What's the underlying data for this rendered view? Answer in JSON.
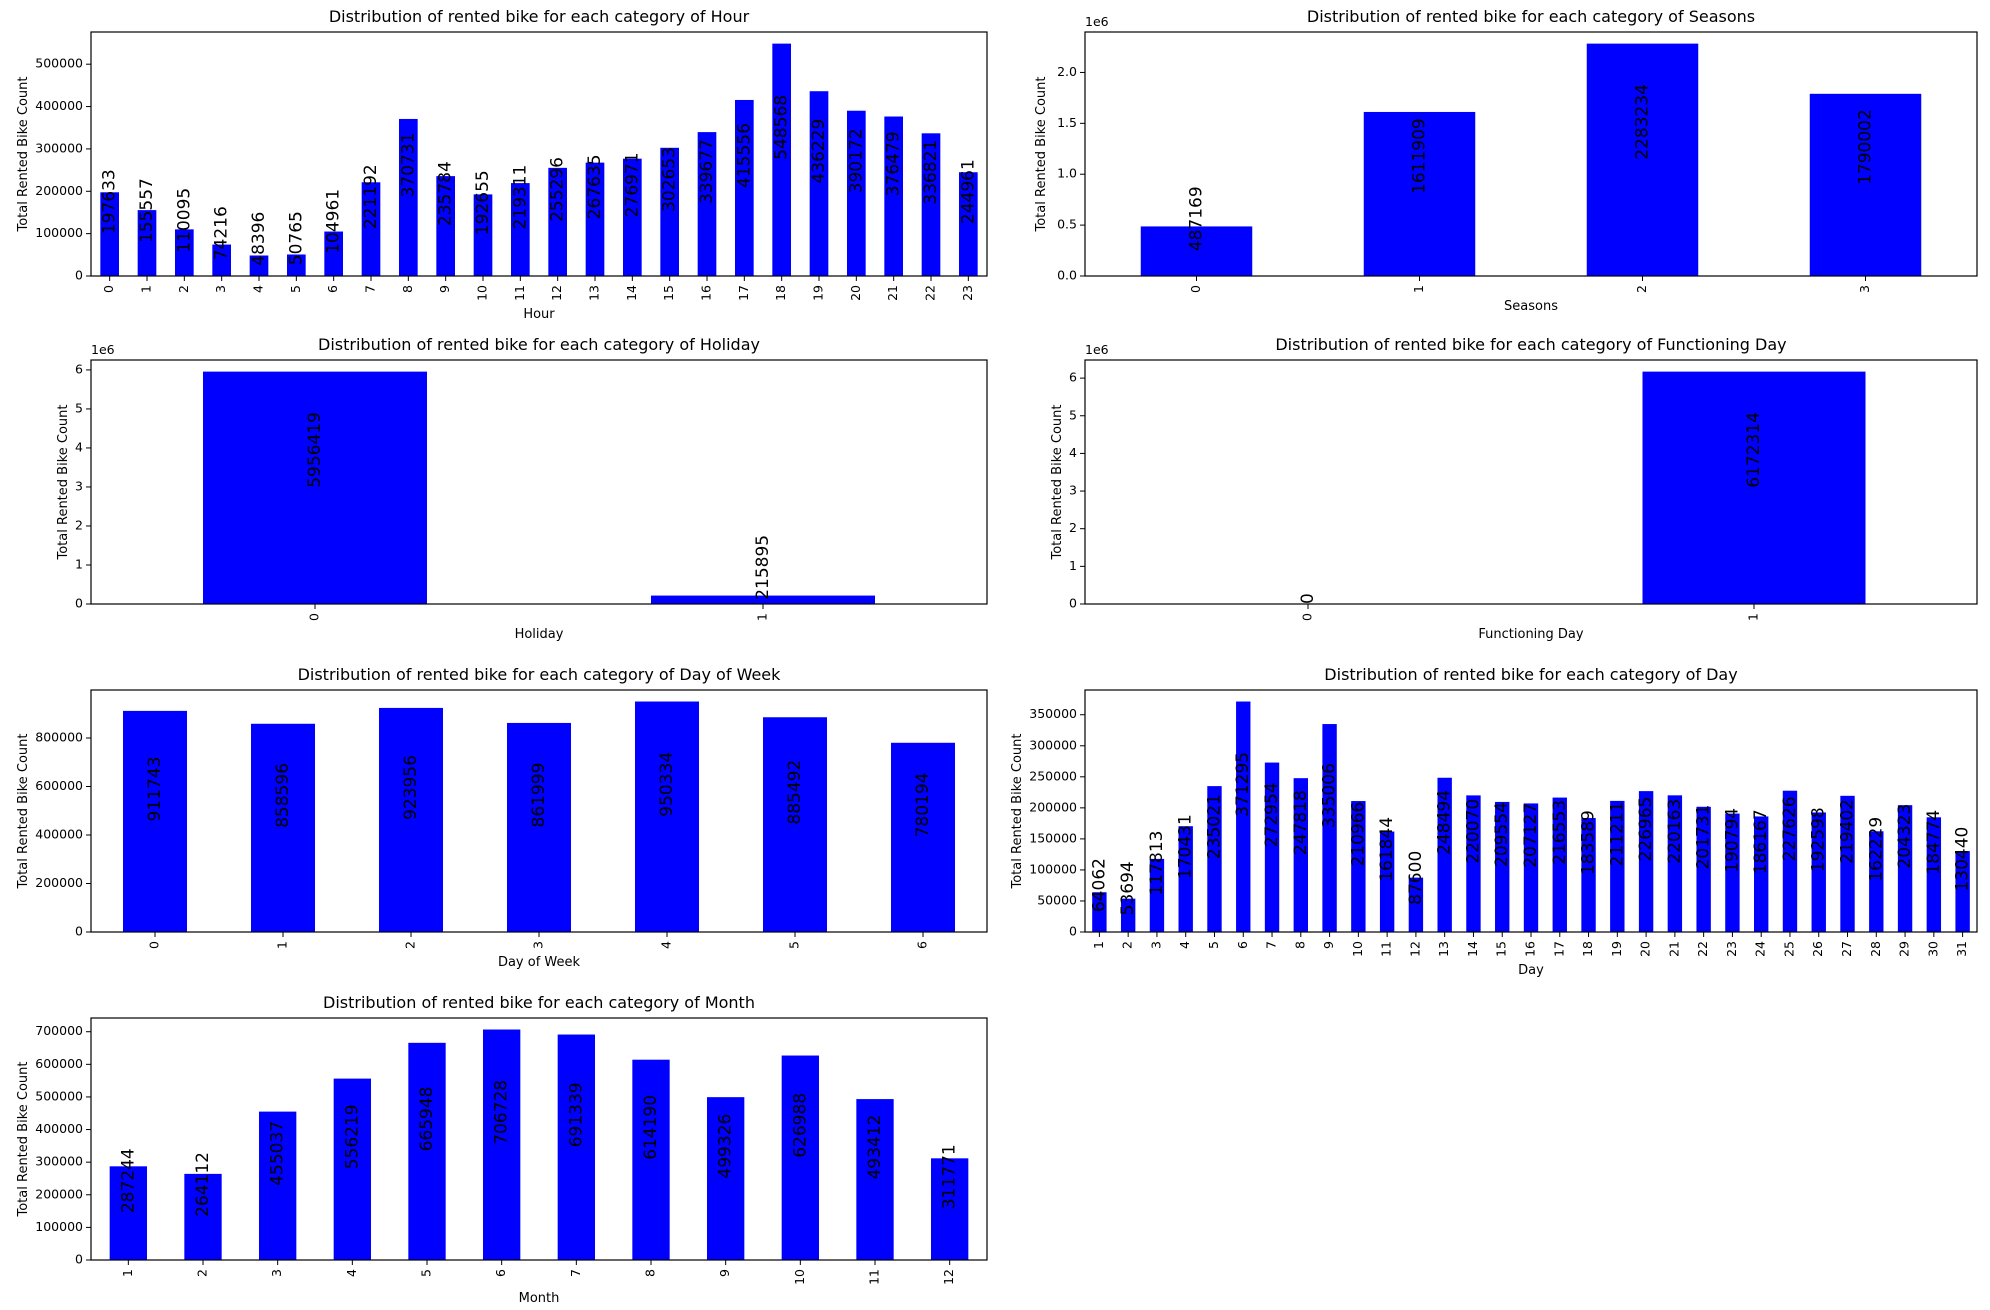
{
  "colors": {
    "bar": "#0000ff",
    "axis": "#000000",
    "background": "#ffffff"
  },
  "chart_data": [
    {
      "type": "bar",
      "title": "Distribution of rented bike for each category of Hour",
      "xlabel": "Hour",
      "ylabel": "Total Rented Bike Count",
      "categories": [
        "0",
        "1",
        "2",
        "3",
        "4",
        "5",
        "6",
        "7",
        "8",
        "9",
        "10",
        "11",
        "12",
        "13",
        "14",
        "15",
        "16",
        "17",
        "18",
        "19",
        "20",
        "21",
        "22",
        "23"
      ],
      "values": [
        197633,
        155557,
        110095,
        74216,
        48396,
        50765,
        104961,
        221192,
        370731,
        235784,
        192655,
        219311,
        255296,
        267635,
        276971,
        302653,
        339677,
        415556,
        548568,
        436229,
        390172,
        376479,
        336821,
        244961
      ],
      "ylim": [
        0,
        576000
      ],
      "yticks": [
        0,
        100000,
        200000,
        300000,
        400000,
        500000
      ],
      "ytick_labels": [
        "0",
        "100000",
        "200000",
        "300000",
        "400000",
        "500000"
      ],
      "offset_text": ""
    },
    {
      "type": "bar",
      "title": "Distribution of rented bike for each category of Seasons",
      "xlabel": "Seasons",
      "ylabel": "Total Rented Bike Count",
      "categories": [
        "0",
        "1",
        "2",
        "3"
      ],
      "values": [
        487169,
        1611909,
        2283234,
        1790002
      ],
      "ylim": [
        0,
        2397396
      ],
      "yticks": [
        0,
        500000,
        1000000,
        1500000,
        2000000
      ],
      "ytick_labels": [
        "0.0",
        "0.5",
        "1.0",
        "1.5",
        "2.0"
      ],
      "offset_text": "1e6"
    },
    {
      "type": "bar",
      "title": "Distribution of rented bike for each category of Holiday",
      "xlabel": "Holiday",
      "ylabel": "Total Rented Bike Count",
      "categories": [
        "0",
        "1"
      ],
      "values": [
        5956419,
        215895
      ],
      "ylim": [
        0,
        6254240
      ],
      "yticks": [
        0,
        1000000,
        2000000,
        3000000,
        4000000,
        5000000,
        6000000
      ],
      "ytick_labels": [
        "0",
        "1",
        "2",
        "3",
        "4",
        "5",
        "6"
      ],
      "offset_text": "1e6"
    },
    {
      "type": "bar",
      "title": "Distribution of rented bike for each category of Functioning Day",
      "xlabel": "Functioning Day",
      "ylabel": "Total Rented Bike Count",
      "categories": [
        "0",
        "1"
      ],
      "values": [
        0,
        6172314
      ],
      "ylim": [
        0,
        6480930
      ],
      "yticks": [
        0,
        1000000,
        2000000,
        3000000,
        4000000,
        5000000,
        6000000
      ],
      "ytick_labels": [
        "0",
        "1",
        "2",
        "3",
        "4",
        "5",
        "6"
      ],
      "offset_text": "1e6"
    },
    {
      "type": "bar",
      "title": "Distribution of rented bike for each category of Day of Week",
      "xlabel": "Day of Week",
      "ylabel": "Total Rented Bike Count",
      "categories": [
        "0",
        "1",
        "2",
        "3",
        "4",
        "5",
        "6"
      ],
      "values": [
        911743,
        858596,
        923956,
        861999,
        950334,
        885492,
        780194
      ],
      "ylim": [
        0,
        997851
      ],
      "yticks": [
        0,
        200000,
        400000,
        600000,
        800000
      ],
      "ytick_labels": [
        "0",
        "200000",
        "400000",
        "600000",
        "800000"
      ],
      "offset_text": ""
    },
    {
      "type": "bar",
      "title": "Distribution of rented bike for each category of Day",
      "xlabel": "Day",
      "ylabel": "Total Rented Bike Count",
      "categories": [
        "1",
        "2",
        "3",
        "4",
        "5",
        "6",
        "7",
        "8",
        "9",
        "10",
        "11",
        "12",
        "13",
        "14",
        "15",
        "16",
        "17",
        "18",
        "19",
        "20",
        "21",
        "22",
        "23",
        "24",
        "25",
        "26",
        "27",
        "28",
        "29",
        "30",
        "31"
      ],
      "values": [
        64062,
        53694,
        117813,
        170431,
        235021,
        371295,
        272954,
        247818,
        335006,
        210966,
        161844,
        87600,
        248494,
        220070,
        209554,
        207127,
        216553,
        183589,
        211211,
        226965,
        220163,
        201731,
        190794,
        186167,
        227626,
        192598,
        219402,
        162229,
        204323,
        184774,
        130440
      ],
      "ylim": [
        0,
        389860
      ],
      "yticks": [
        0,
        50000,
        100000,
        150000,
        200000,
        250000,
        300000,
        350000
      ],
      "ytick_labels": [
        "0",
        "50000",
        "100000",
        "150000",
        "200000",
        "250000",
        "300000",
        "350000"
      ],
      "offset_text": ""
    },
    {
      "type": "bar",
      "title": "Distribution of rented bike for each category of Month",
      "xlabel": "Month",
      "ylabel": "Total Rented Bike Count",
      "categories": [
        "1",
        "2",
        "3",
        "4",
        "5",
        "6",
        "7",
        "8",
        "9",
        "10",
        "11",
        "12"
      ],
      "values": [
        287244,
        264112,
        455037,
        556219,
        665948,
        706728,
        691339,
        614190,
        499326,
        626988,
        493412,
        311771
      ],
      "ylim": [
        0,
        742064
      ],
      "yticks": [
        0,
        100000,
        200000,
        300000,
        400000,
        500000,
        600000,
        700000
      ],
      "ytick_labels": [
        "0",
        "100000",
        "200000",
        "300000",
        "400000",
        "500000",
        "600000",
        "700000"
      ],
      "offset_text": ""
    }
  ]
}
